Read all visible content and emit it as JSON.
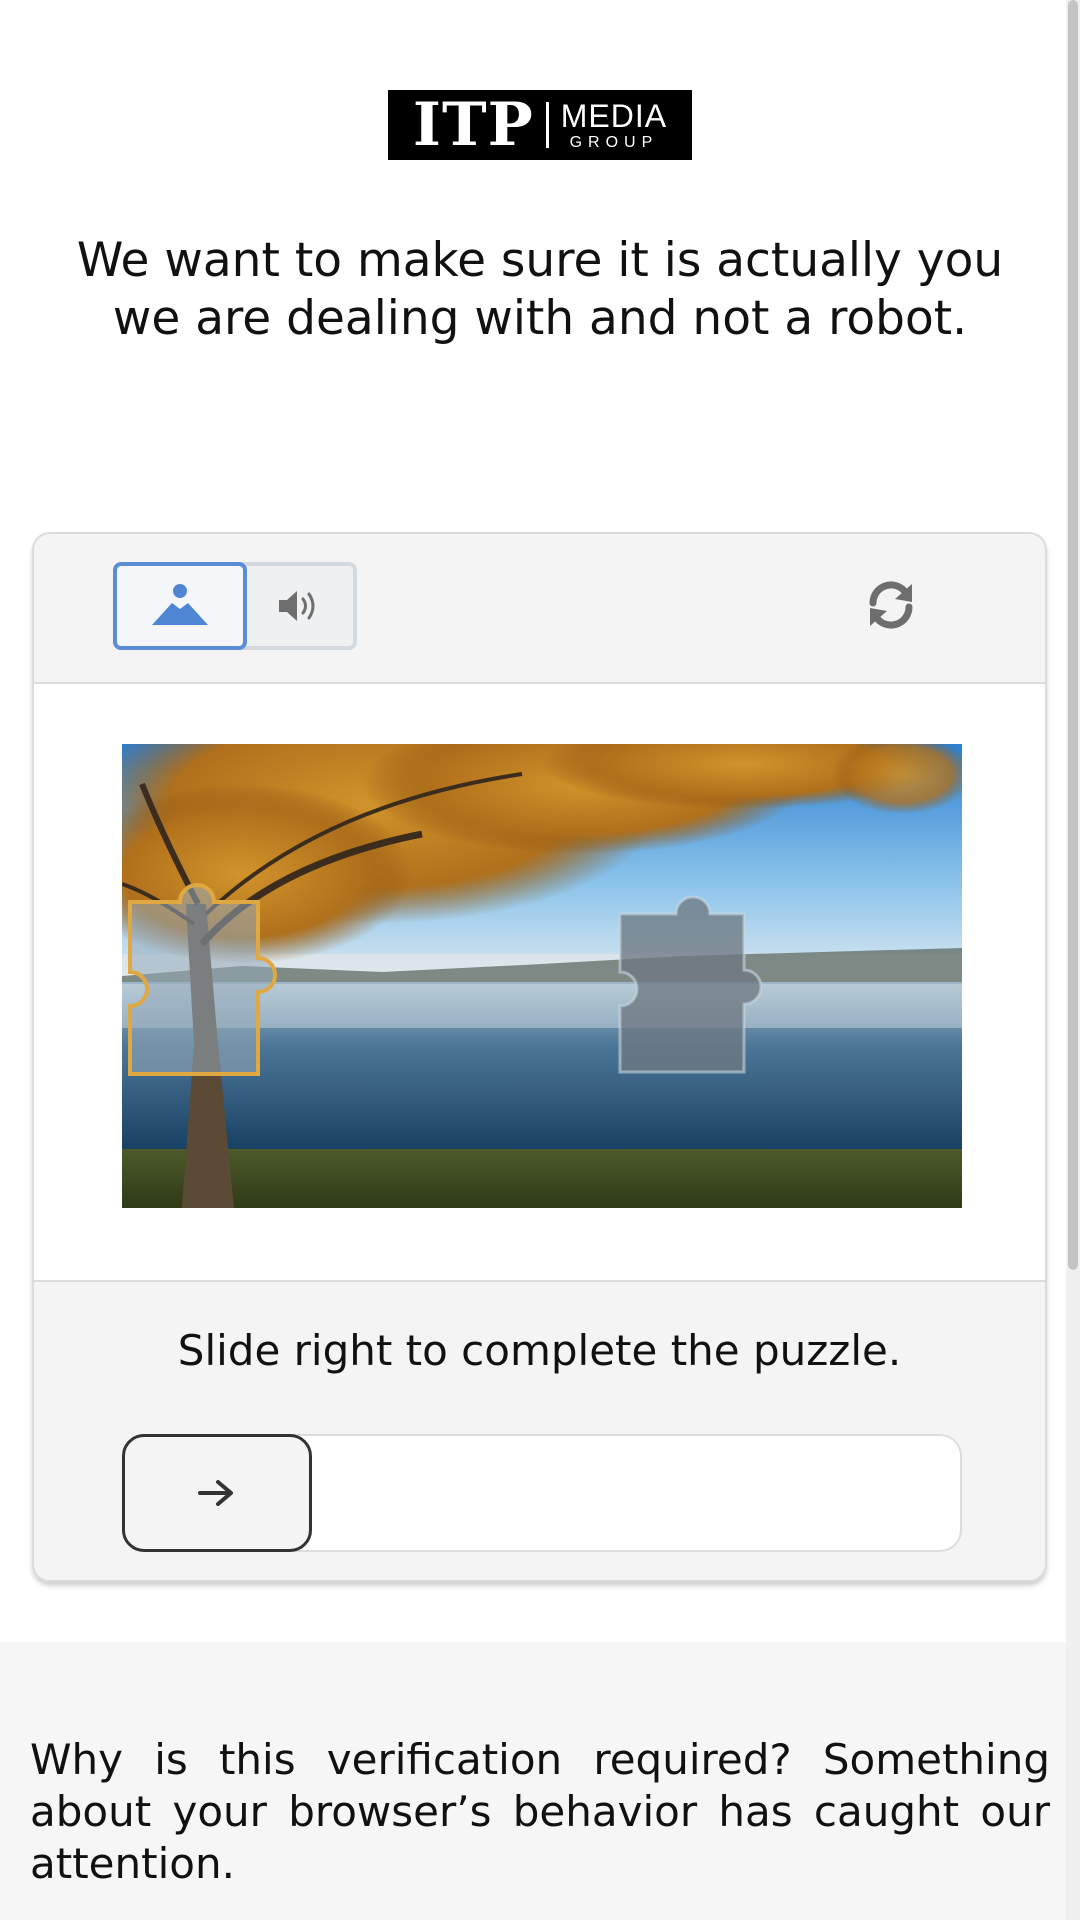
{
  "logo": {
    "main": "ITP",
    "media": "MEDIA",
    "group": "GROUP"
  },
  "headline": "We want to make sure it is actually you we are dealing with and not a robot.",
  "captcha": {
    "modes": {
      "image_icon": "image-mountain-icon",
      "audio_icon": "speaker-icon",
      "active": "image"
    },
    "refresh_icon": "refresh-icon",
    "instruction": "Slide right to complete the puzzle.",
    "slider": {
      "handle_icon": "arrow-right-icon",
      "progress": 0
    }
  },
  "why": "Why is this verification required? Something about your browser’s behavior has caught our attention.",
  "colors": {
    "accent": "#5b8dd6",
    "piece_outline": "#e0a840",
    "card_bg": "#f4f4f4"
  }
}
